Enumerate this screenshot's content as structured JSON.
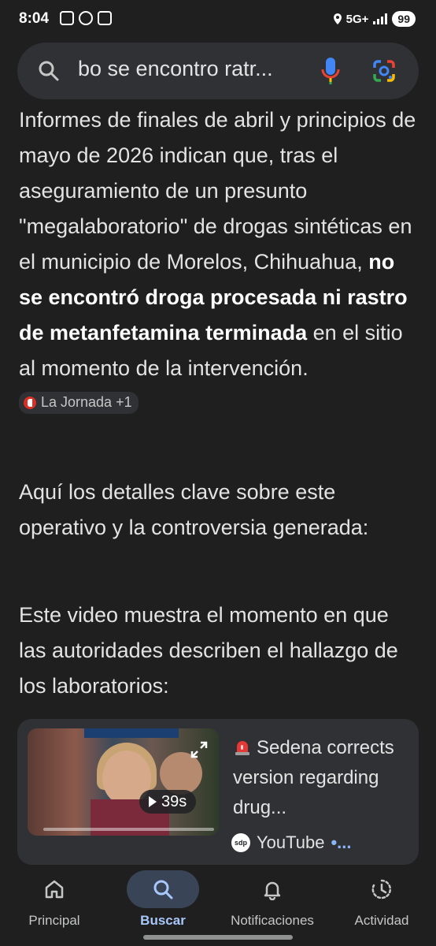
{
  "status_bar": {
    "time": "8:04",
    "network": "5G+",
    "battery": "99"
  },
  "search": {
    "query": "bo se encontro ratr..."
  },
  "answer": {
    "intro_before_bold": "Informes de finales de abril y principios de mayo de 2026 indican que, tras el aseguramiento de un presunto \"megalaboratorio\" de drogas sintéticas en el municipio de Morelos, Chihuahua, ",
    "intro_bold": "no se encontró droga procesada ni rastro de metanfetamina terminada",
    "intro_after_bold": " en el sitio al momento de la intervención.",
    "source_chip": "La Jornada +1",
    "details_intro": "Aquí los detalles clave sobre este operativo y la controversia generada:",
    "video_intro": "Este video muestra el momento en que las autoridades describen el hallazgo de los laboratorios:"
  },
  "video_card": {
    "duration": "39s",
    "title": "Sedena corrects version regarding drug...",
    "source_logo": "sdp",
    "source": "YouTube",
    "more": "•..."
  },
  "bottom_nav": [
    {
      "label": "Principal",
      "icon": "home-icon"
    },
    {
      "label": "Buscar",
      "icon": "search-icon",
      "active": true
    },
    {
      "label": "Notificaciones",
      "icon": "bell-icon"
    },
    {
      "label": "Actividad",
      "icon": "activity-icon"
    }
  ],
  "colors": {
    "background": "#1f1f1f",
    "surface": "#303134",
    "accent": "#a8c7fa"
  }
}
